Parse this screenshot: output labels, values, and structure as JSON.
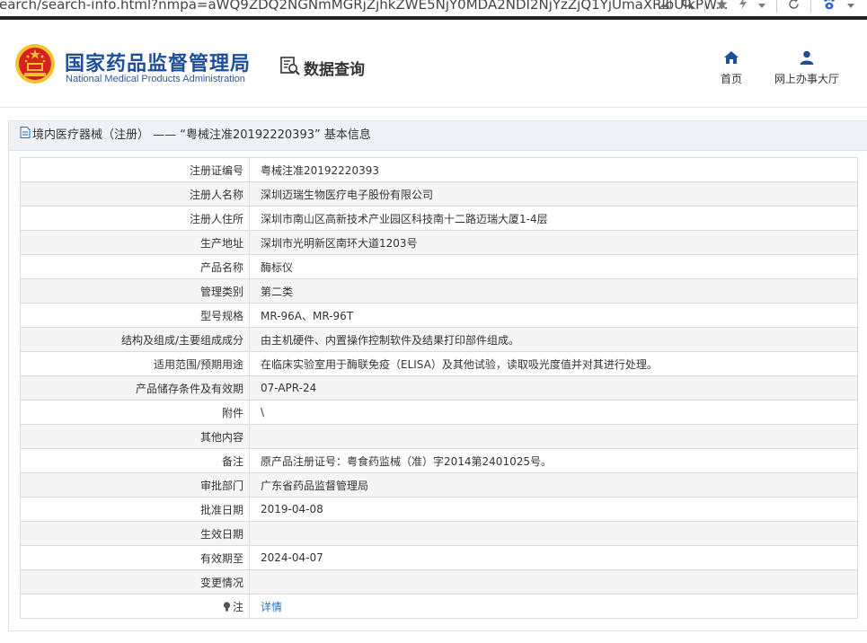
{
  "browser": {
    "url": "earch/search-info.html?nmpa=aWQ9ZDQ2NGNmMGRjZjhkZWE5NjY0MDA2NDI2NjYzZjQ1YjUmaXRlbUlkPW...",
    "tool_icons": [
      "image-icon",
      "zoom-icon",
      "star-icon",
      "lightning-icon",
      "chevron-down-icon",
      "refresh-icon",
      "baidu-paw-icon"
    ]
  },
  "header": {
    "title_cn": "国家药品监督管理局",
    "title_en": "National Medical Products Administration",
    "data_query": "数据查询",
    "nav": [
      {
        "label": "首页",
        "icon": "home-icon"
      },
      {
        "label": "网上办事大厅",
        "icon": "user-icon"
      }
    ]
  },
  "panel": {
    "title": "境内医疗器械（注册） —— “粤械注准20192220393” 基本信息"
  },
  "rows": [
    {
      "label": "注册证编号",
      "value": "粤械注准20192220393"
    },
    {
      "label": "注册人名称",
      "value": "深圳迈瑞生物医疗电子股份有限公司"
    },
    {
      "label": "注册人住所",
      "value": "深圳市南山区高新技术产业园区科技南十二路迈瑞大厦1-4层"
    },
    {
      "label": "生产地址",
      "value": "深圳市光明新区南环大道1203号"
    },
    {
      "label": "产品名称",
      "value": "酶标仪"
    },
    {
      "label": "管理类别",
      "value": "第二类"
    },
    {
      "label": "型号规格",
      "value": "MR-96A、MR-96T"
    },
    {
      "label": "结构及组成/主要组成成分",
      "value": "由主机硬件、内置操作控制软件及结果打印部件组成。"
    },
    {
      "label": "适用范围/预期用途",
      "value": "在临床实验室用于酶联免疫（ELISA）及其他试验，读取吸光度值并对其进行处理。"
    },
    {
      "label": "产品储存条件及有效期",
      "value": "07-APR-24"
    },
    {
      "label": "附件",
      "value": "\\"
    },
    {
      "label": "其他内容",
      "value": ""
    },
    {
      "label": "备注",
      "value": "原产品注册证号：粤食药监械（准）字2014第2401025号。"
    },
    {
      "label": "审批部门",
      "value": "广东省药品监督管理局"
    },
    {
      "label": "批准日期",
      "value": "2019-04-08"
    },
    {
      "label": "生效日期",
      "value": ""
    },
    {
      "label": "有效期至",
      "value": "2024-04-07"
    },
    {
      "label": "变更情况",
      "value": ""
    },
    {
      "label": "注",
      "value": "详情"
    }
  ],
  "colors": {
    "brand_blue": "#1f4f99",
    "link": "#2a6ebb",
    "emblem_red": "#d6221e",
    "emblem_gold": "#f2c230"
  }
}
